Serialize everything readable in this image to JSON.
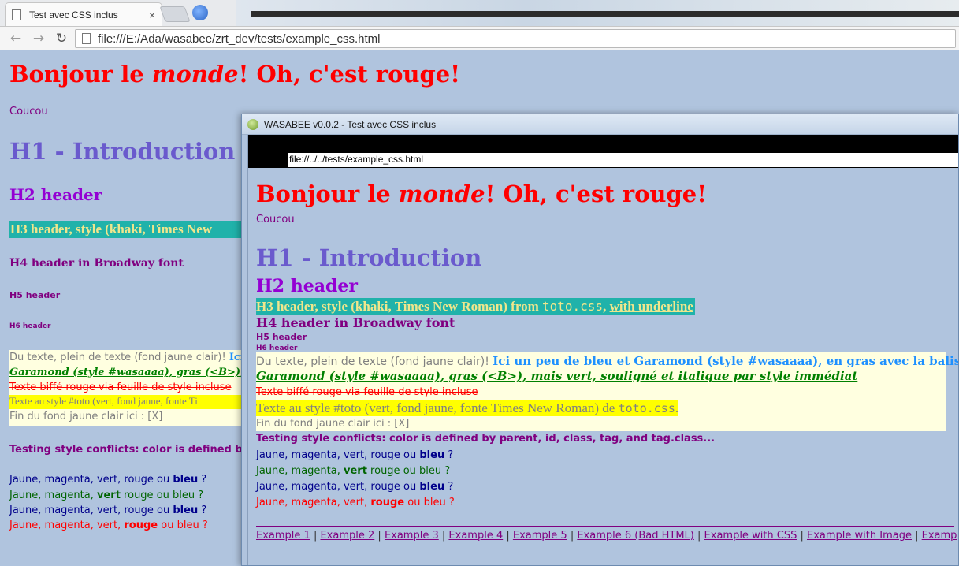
{
  "browser": {
    "tab_title": "Test avec CSS inclus",
    "tab_close": "×",
    "url": "file:///E:/Ada/wasabee/zrt_dev/tests/example_css.html",
    "nav": {
      "back": "←",
      "forward": "→",
      "reload": "↻"
    }
  },
  "page": {
    "title_pre": "Bonjour le ",
    "title_em": "monde",
    "title_post": "! Oh, c'est rouge!",
    "coucou": "Coucou",
    "h1": "H1 - Introduction",
    "h2": "H2 header",
    "h3": "H3 header, style (khaki, Times New",
    "h4": "H4 header in Broadway font",
    "h5": "H5 header",
    "h6": "H6 header",
    "box_line1_gray": "Du texte, plein de texte (fond jaune clair)! ",
    "box_line1_blue": "Ici",
    "box_line2": "Garamond (style #wasaaaa), gras (<B>), mais vert",
    "box_line3": "Texte biffé rouge via feuille de style incluse",
    "box_line4": "Texte au style #toto (vert, fond jaune, fonte Ti",
    "box_line5": "Fin du fond jaune clair ici : [X]",
    "conflicts": "Testing style conflicts: color is defined by pa",
    "colors_a": "Jaune, magenta, vert, rouge ou ",
    "colors_bleu": "bleu",
    "colors_q": " ?",
    "colors_b_pre": "Jaune, magenta, ",
    "colors_vert": "vert",
    "colors_b_post": " rouge ou bleu ?",
    "colors_d_pre": "Jaune, magenta, vert, ",
    "colors_rouge": "rouge",
    "colors_d_post": " ou bleu ?"
  },
  "wasabee": {
    "window_title": "WASABEE v0.0.2 - Test avec CSS inclus",
    "url": "file://../../tests/example_css.html",
    "h3_pre": "H3 header, style (khaki, Times New Roman) from ",
    "h3_code": "toto.css",
    "h3_mid": ", ",
    "h3_ul": "with underline",
    "h4": "H4 header in Broadway font",
    "box_line1_gray": "Du texte, plein de texte (fond jaune clair)! ",
    "box_line1_blue": "Ici un peu de bleu et Garamond (style #wasaaaa), en gras avec la balise <B>.",
    "box_line2": "Garamond (style #wasaaaa), gras (<B>), mais vert, souligné et italique par style immédiat",
    "box_line3": "Texte biffé rouge via feuille de style incluse",
    "box_line4_pre": "Texte au style #toto (vert, fond jaune, fonte Times New Roman) de ",
    "box_line4_code": "toto.css",
    "box_line4_post": ".",
    "box_line5": "Fin du fond jaune clair ici : [X]",
    "conflicts": "Testing style conflicts: color is defined by parent, id, class, tag, and tag.class...",
    "links": [
      "Example 1",
      "Example 2",
      "Example 3",
      "Example 4",
      "Example 5",
      "Example 6 (Bad HTML)",
      "Example with CSS",
      "Example with Image",
      "Examp"
    ],
    "link_sep": " | "
  },
  "colors": {
    "page_bg": "#b0c4de",
    "red": "#ff0000",
    "slate_blue": "#6a5acd",
    "dark_violet": "#9400d3",
    "light_sea_green": "#20b2aa",
    "khaki": "#f0e68c",
    "purple": "#800080",
    "light_yellow": "#ffffe0",
    "yellow": "#ffff00"
  }
}
